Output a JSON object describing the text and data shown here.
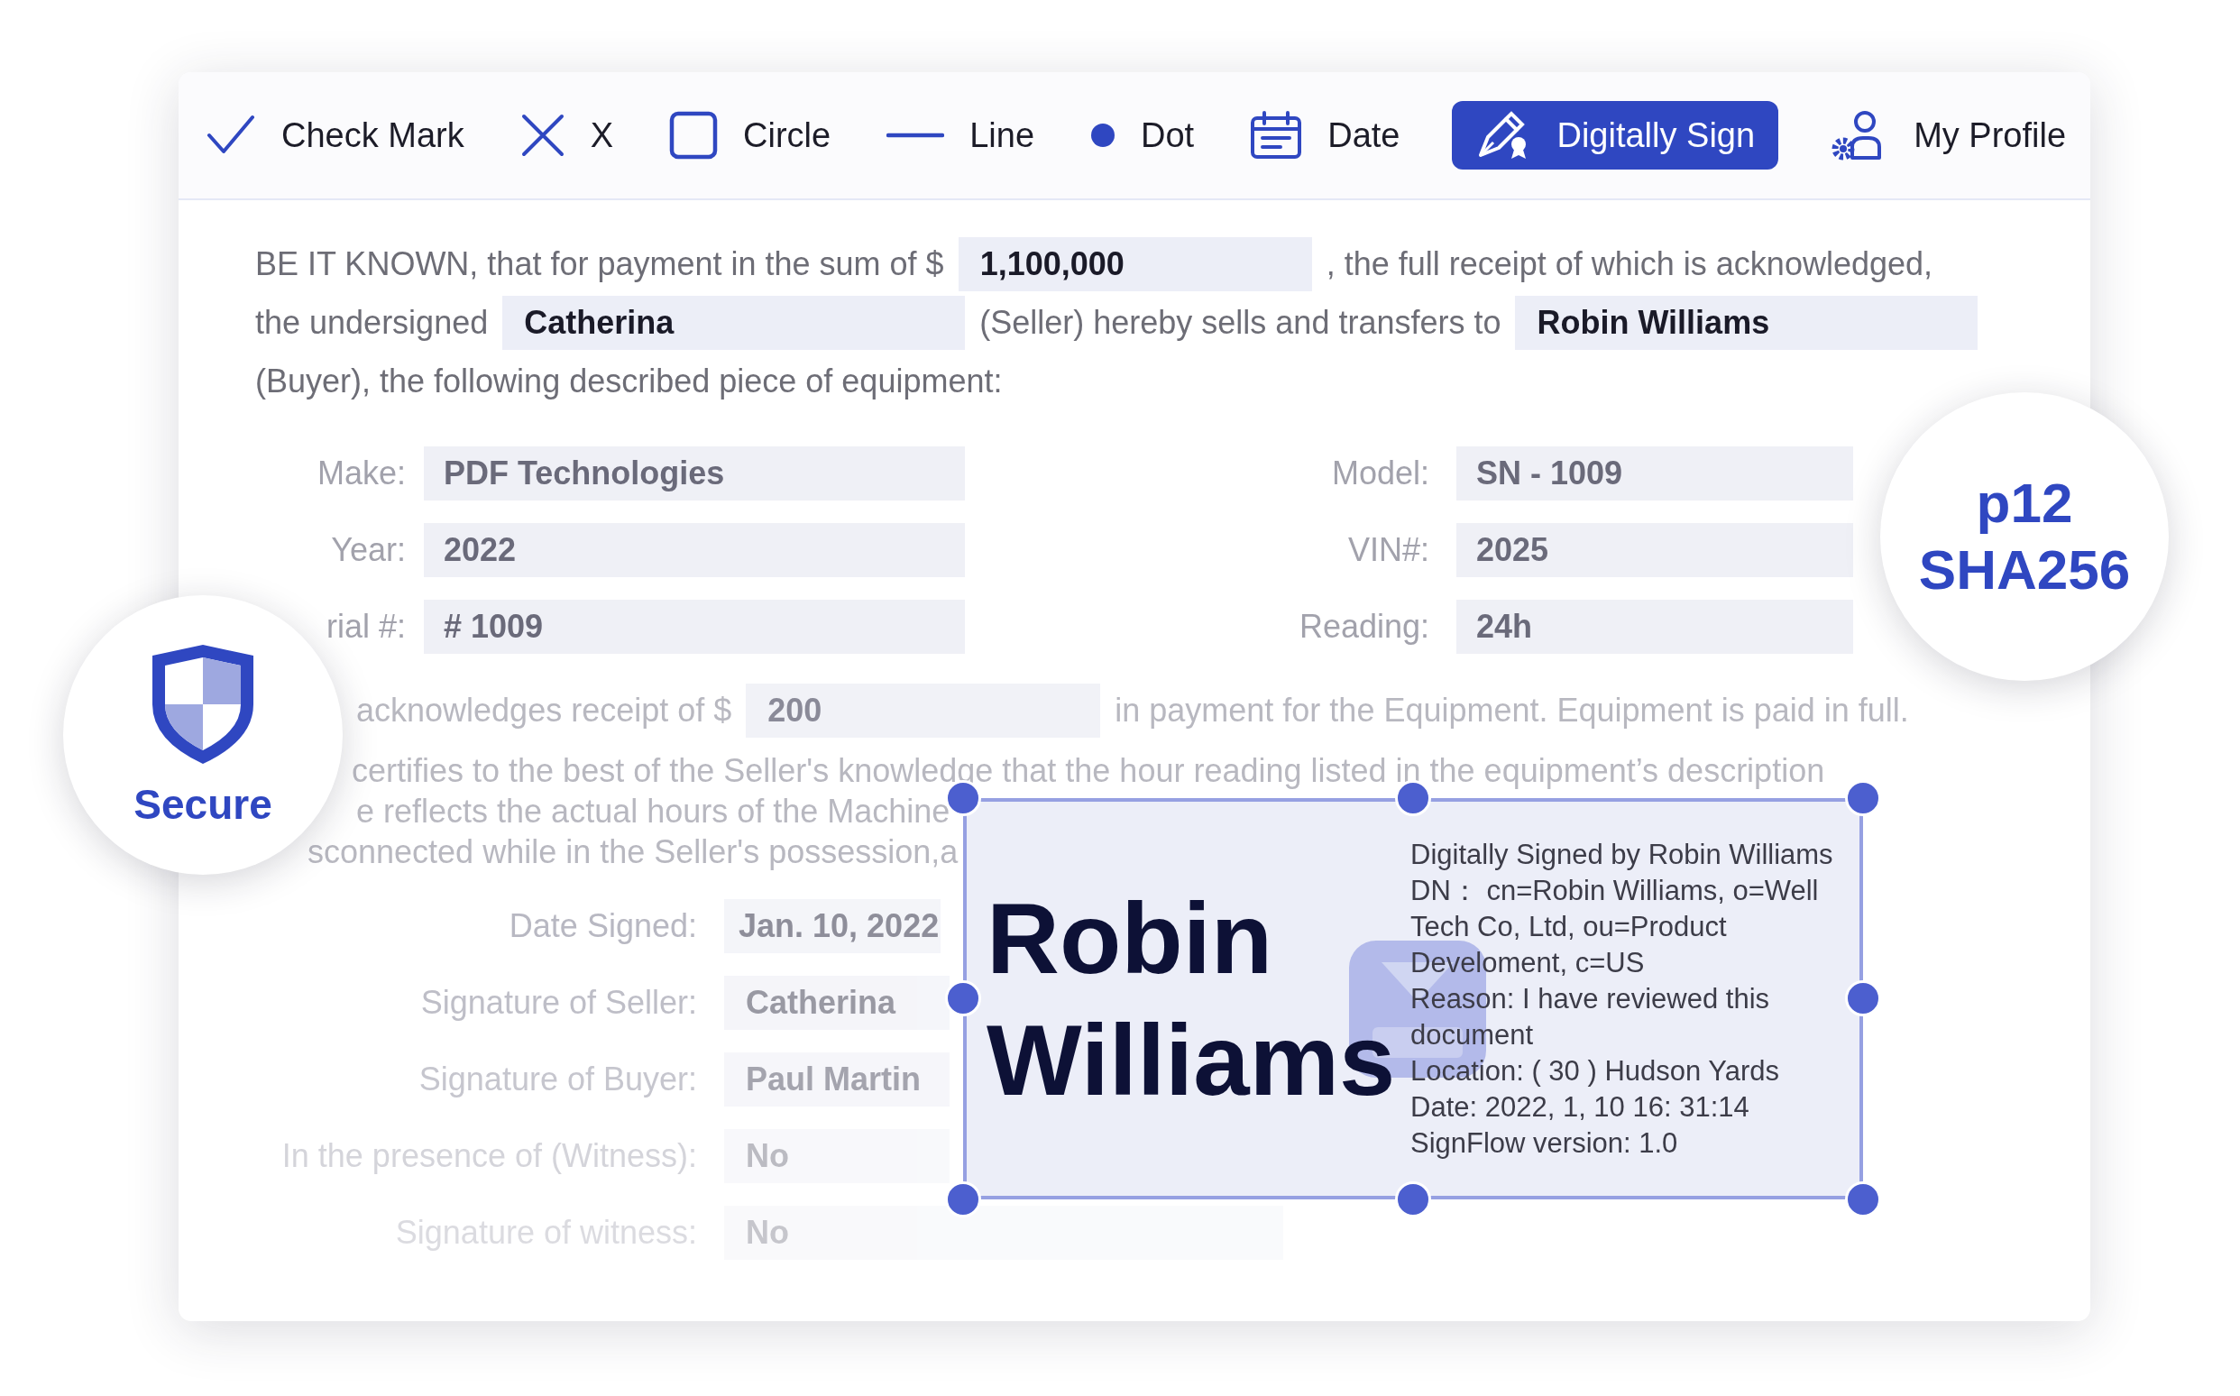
{
  "toolbar": {
    "tools": [
      {
        "kind": "check",
        "label": "Check Mark",
        "selected": false
      },
      {
        "kind": "cross",
        "label": "X",
        "selected": false
      },
      {
        "kind": "square",
        "label": "Circle",
        "selected": false
      },
      {
        "kind": "line",
        "label": "Line",
        "selected": false
      },
      {
        "kind": "dot",
        "label": "Dot",
        "selected": false
      },
      {
        "kind": "date",
        "label": "Date",
        "selected": false
      },
      {
        "kind": "sign",
        "label": "Digitally Sign",
        "selected": true
      },
      {
        "kind": "profile",
        "label": "My Profile",
        "selected": false
      }
    ]
  },
  "agreement": {
    "lines": [
      [
        {
          "kind": "text",
          "text": "BE IT KNOWN, that for payment in the sum of $"
        },
        {
          "kind": "field",
          "value": "1,100,000"
        },
        {
          "kind": "text",
          "text": ", the full receipt of which is acknowledged,"
        }
      ],
      [
        {
          "kind": "text",
          "text": "the undersigned"
        },
        {
          "kind": "field",
          "value": "Catherina"
        },
        {
          "kind": "text",
          "text": "(Seller) hereby sells and transfers to"
        },
        {
          "kind": "field",
          "value": "Robin Williams"
        }
      ],
      [
        {
          "kind": "text",
          "text": "(Buyer), the following described piece of equipment:"
        }
      ]
    ]
  },
  "equipment": [
    {
      "label": "Make:",
      "value": "PDF Technologies"
    },
    {
      "label": "Model:",
      "value": "SN - 1009"
    },
    {
      "label": "Year:",
      "value": "2022"
    },
    {
      "label": "VIN#:",
      "value": "2025"
    },
    {
      "label": "rial #:",
      "value": "# 1009"
    },
    {
      "label": "Reading:",
      "value": "24h"
    }
  ],
  "receipt": {
    "before": "acknowledges receipt of $",
    "value": "200",
    "after": "in payment for the Equipment. Equipment is paid in full."
  },
  "certification": [
    "certifies to the best of the Seller's knowledge that the hour reading listed in the equipment’s description",
    "e reflects the actual hours of the Machine",
    "sconnected while in the Seller's possession,a"
  ],
  "signatures": [
    {
      "label": "Date Signed:",
      "value": "Jan. 10, 2022"
    },
    {
      "label": "Signature of Seller:",
      "value": "Catherina"
    },
    {
      "label": "Signature of Buyer:",
      "value": "Paul Martin"
    },
    {
      "label": "In the presence of (Witness):",
      "value": "No"
    },
    {
      "label": "Signature of witness:",
      "value": "No"
    }
  ],
  "secure_badge": {
    "label": "Secure"
  },
  "algorithm_badge": {
    "lines": [
      "p12",
      "SHA256"
    ]
  },
  "signature_box": {
    "name": "Robin Williams",
    "details": [
      "Digitally Signed by Robin Williams",
      "DN： cn=Robin Williams, o=Well",
      "Tech Co, Ltd, ou=Product",
      "Develoment, c=US",
      "Reason: I have reviewed this",
      "document",
      "Location: ( 30 ) Hudson Yards",
      "Date: 2022, 1, 10 16: 31:14",
      "SignFlow version: 1.0"
    ]
  }
}
